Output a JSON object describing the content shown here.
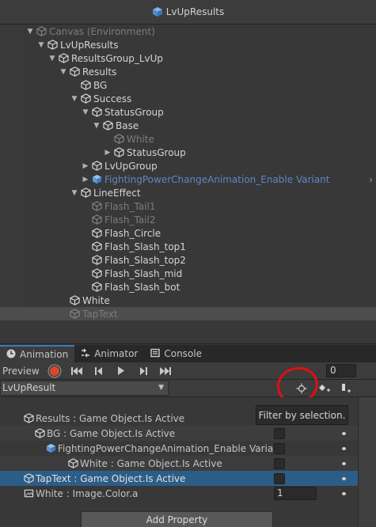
{
  "hierarchy": {
    "title": "LvUpResults",
    "rows": [
      {
        "label": "Canvas (Environment)",
        "indent": 0,
        "arrow": "down",
        "style": "dim",
        "icon": "cube-outline-icon"
      },
      {
        "label": "LvUpResults",
        "indent": 1,
        "arrow": "down",
        "style": "normal",
        "icon": "cube-icon"
      },
      {
        "label": "ResultsGroup_LvUp",
        "indent": 2,
        "arrow": "down",
        "style": "normal",
        "icon": "cube-icon"
      },
      {
        "label": "Results",
        "indent": 3,
        "arrow": "down",
        "style": "normal",
        "icon": "cube-icon"
      },
      {
        "label": "BG",
        "indent": 4,
        "arrow": "none",
        "style": "normal",
        "icon": "cube-icon"
      },
      {
        "label": "Success",
        "indent": 4,
        "arrow": "down",
        "style": "normal",
        "icon": "cube-icon"
      },
      {
        "label": "StatusGroup",
        "indent": 5,
        "arrow": "down",
        "style": "normal",
        "icon": "cube-icon"
      },
      {
        "label": "Base",
        "indent": 6,
        "arrow": "down",
        "style": "normal",
        "icon": "cube-icon"
      },
      {
        "label": "White",
        "indent": 7,
        "arrow": "none",
        "style": "dim",
        "icon": "cube-icon"
      },
      {
        "label": "StatusGroup",
        "indent": 7,
        "arrow": "right",
        "style": "normal",
        "icon": "cube-icon"
      },
      {
        "label": "LvUpGroup",
        "indent": 5,
        "arrow": "right",
        "style": "normal",
        "icon": "cube-icon"
      },
      {
        "label": "FightingPowerChangeAnimation_Enable Variant",
        "indent": 5,
        "arrow": "right",
        "style": "prefab",
        "icon": "prefab-variant-icon"
      },
      {
        "label": "LineEffect",
        "indent": 4,
        "arrow": "down",
        "style": "normal",
        "icon": "cube-icon"
      },
      {
        "label": "Flash_Tail1",
        "indent": 5,
        "arrow": "none",
        "style": "dim",
        "icon": "cube-icon"
      },
      {
        "label": "Flash_Tail2",
        "indent": 5,
        "arrow": "none",
        "style": "dim",
        "icon": "cube-icon"
      },
      {
        "label": "Flash_Circle",
        "indent": 5,
        "arrow": "none",
        "style": "normal",
        "icon": "cube-icon"
      },
      {
        "label": "Flash_Slash_top1",
        "indent": 5,
        "arrow": "none",
        "style": "normal",
        "icon": "cube-icon"
      },
      {
        "label": "Flash_Slash_top2",
        "indent": 5,
        "arrow": "none",
        "style": "normal",
        "icon": "cube-icon"
      },
      {
        "label": "Flash_Slash_mid",
        "indent": 5,
        "arrow": "none",
        "style": "normal",
        "icon": "cube-icon"
      },
      {
        "label": "Flash_Slash_bot",
        "indent": 5,
        "arrow": "none",
        "style": "normal",
        "icon": "cube-icon"
      },
      {
        "label": "White",
        "indent": 3,
        "arrow": "none",
        "style": "normal",
        "icon": "cube-icon"
      },
      {
        "label": "TapText",
        "indent": 3,
        "arrow": "none",
        "style": "dim",
        "icon": "cube-icon",
        "selected": true
      }
    ]
  },
  "tabs": [
    {
      "label": "Animation",
      "icon": "animation-clock-icon",
      "active": true
    },
    {
      "label": "Animator",
      "icon": "animator-icon",
      "active": false
    },
    {
      "label": "Console",
      "icon": "console-icon",
      "active": false
    }
  ],
  "toolbar": {
    "preview_label": "Preview",
    "record_icon": "record-icon",
    "frame_value": "0",
    "clip_name": "LvUpResult",
    "filter_icon": "filter-by-selection-icon",
    "add_keyframe_icon": "add-keyframe-icon",
    "add_event_icon": "add-event-icon"
  },
  "tooltip": {
    "text": "Filter by selection."
  },
  "properties": [
    {
      "label": "Results : Game Object.Is Active",
      "indent": 0,
      "icon": "cube-outline-icon",
      "control": "none",
      "style": "normal"
    },
    {
      "label": "BG : Game Object.Is Active",
      "indent": 1,
      "icon": "cube-outline-icon",
      "control": "toggle",
      "style": "alt"
    },
    {
      "label": "FightingPowerChangeAnimation_Enable Varia",
      "indent": 2,
      "icon": "prefab-variant-icon",
      "control": "toggle",
      "style": "normal"
    },
    {
      "label": "White : Game Object.Is Active",
      "indent": 4,
      "icon": "cube-outline-icon",
      "control": "toggle",
      "style": "alt"
    },
    {
      "label": "TapText : Game Object.Is Active",
      "indent": 0,
      "icon": "cube-outline-icon",
      "control": "toggle",
      "style": "selected"
    },
    {
      "label": "White : Image.Color.a",
      "indent": 0,
      "icon": "image-component-icon",
      "control": "value",
      "value": "1",
      "style": "normal"
    }
  ],
  "add_property_label": "Add Property",
  "colors": {
    "selection_blue": "#2c5d87",
    "prefab_blue": "#5f86c6",
    "record_red": "#d9472f",
    "annotation_red": "#e01010"
  }
}
